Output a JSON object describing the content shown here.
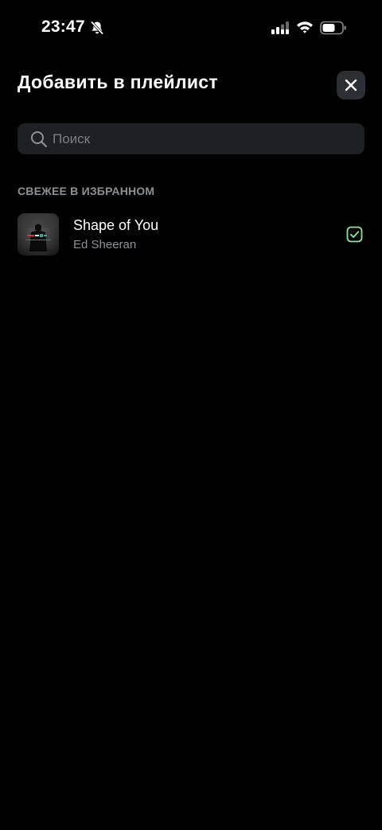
{
  "status_bar": {
    "time": "23:47",
    "icons": [
      "bell-slash-icon",
      "signal-icon",
      "wifi-icon",
      "battery-icon"
    ]
  },
  "header": {
    "title": "Добавить в плейлист",
    "close_icon": "close-icon"
  },
  "search": {
    "placeholder": "Поиск",
    "value": "",
    "icon": "search-icon"
  },
  "section": {
    "label": "СВЕЖЕЕ В ИЗБРАННОМ",
    "tracks": [
      {
        "title": "Shape of You",
        "artist": "Ed Sheeran",
        "checked": true
      }
    ]
  },
  "colors": {
    "background": "#000000",
    "search_bg": "#1d2024",
    "close_bg": "#2c2f33",
    "muted_text": "#8c9196",
    "check_accent": "#8fe39a"
  }
}
